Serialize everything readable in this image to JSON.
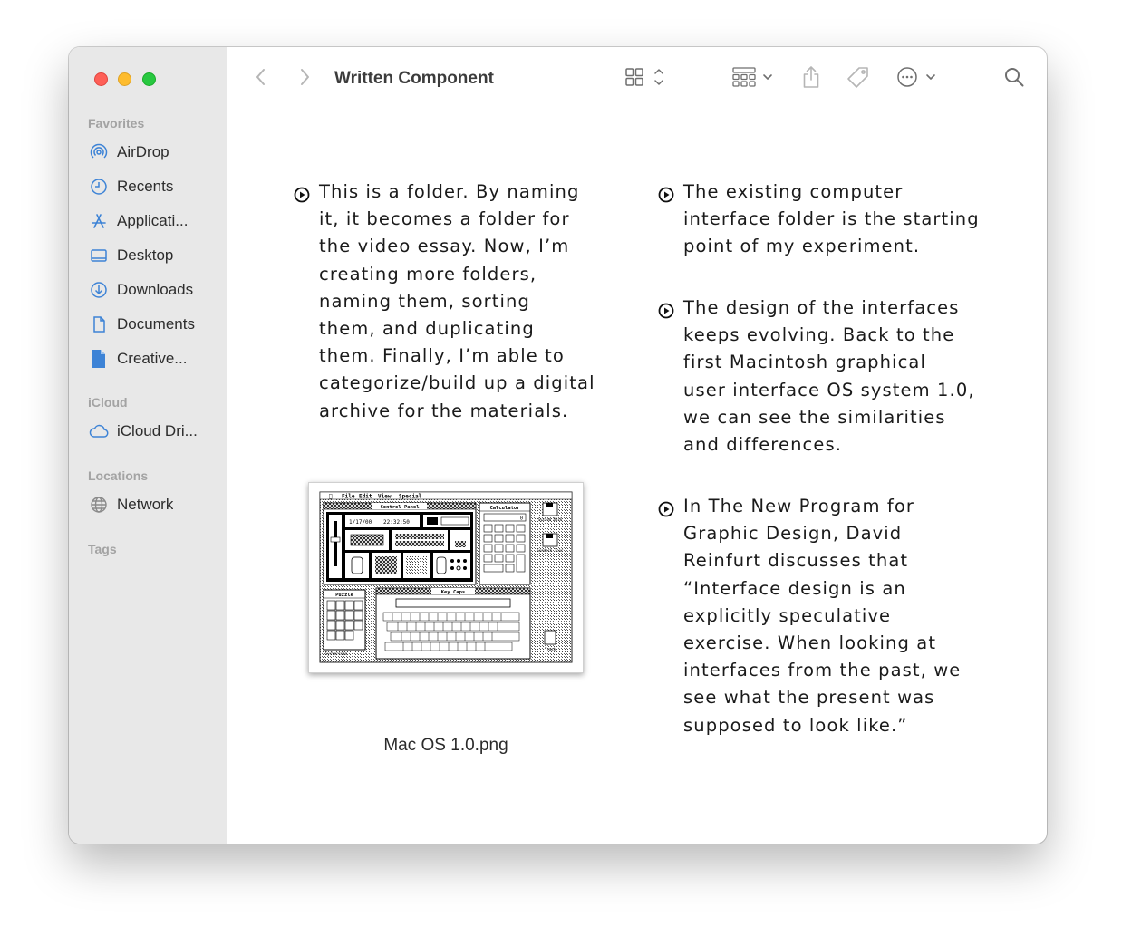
{
  "window": {
    "title": "Written Component"
  },
  "sidebar": {
    "sections": [
      {
        "label": "Favorites",
        "items": [
          {
            "label": "AirDrop",
            "icon": "airdrop-icon"
          },
          {
            "label": "Recents",
            "icon": "clock-icon"
          },
          {
            "label": "Applicati...",
            "icon": "applications-icon"
          },
          {
            "label": "Desktop",
            "icon": "desktop-icon"
          },
          {
            "label": "Downloads",
            "icon": "downloads-icon"
          },
          {
            "label": "Documents",
            "icon": "document-icon"
          },
          {
            "label": "Creative...",
            "icon": "file-icon"
          }
        ]
      },
      {
        "label": "iCloud",
        "items": [
          {
            "label": "iCloud Dri...",
            "icon": "cloud-icon"
          }
        ]
      },
      {
        "label": "Locations",
        "items": [
          {
            "label": "Network",
            "icon": "network-globe-icon"
          }
        ]
      },
      {
        "label": "Tags",
        "items": []
      }
    ]
  },
  "toolbar": {
    "icons": [
      "back-chevron-icon",
      "forward-chevron-icon",
      "grid-view-icon",
      "group-icon",
      "share-icon",
      "tag-icon",
      "more-icon",
      "search-icon"
    ]
  },
  "content": {
    "left_paragraph": "This is a folder. By naming\nit, it becomes a folder for\nthe video essay. Now, I’m\ncreating more folders,\nnaming them, sorting\nthem, and duplicating\nthem. Finally, I’m able to\ncategorize/build up a digital\narchive for the materials.",
    "right_paragraphs": [
      "The existing computer\ninterface folder is the starting\npoint of my experiment.",
      "The design of the interfaces\nkeeps evolving. Back to the\nfirst Macintosh graphical\nuser interface OS system 1.0,\nwe can see the similarities\nand differences.",
      "In The New Program for\nGraphic Design, David\nReinfurt discusses that\n“Interface design is an\nexplicitly speculative\nexercise. When looking at\ninterfaces from the past, we\nsee what the present was\nsupposed to look like.”"
    ],
    "file_caption": "Mac OS 1.0.png",
    "thumbnail": {
      "menu": [
        "File",
        "Edit",
        "View",
        "Special"
      ],
      "control_panel_title": "Control Panel",
      "date": "1/17/00",
      "time": "22:32:50",
      "calculator_title": "Calculator",
      "calculator_display": "0",
      "puzzle_title": "Puzzle",
      "keycaps_title": "Key Caps",
      "disk_label": "System Disk",
      "disk2_label": "Sundeck Tour",
      "trash_label": "Trash",
      "version_label": "SysVersion"
    }
  },
  "colors": {
    "accent": "#3d83d6",
    "sidebar_bg": "#e8e8e8"
  }
}
